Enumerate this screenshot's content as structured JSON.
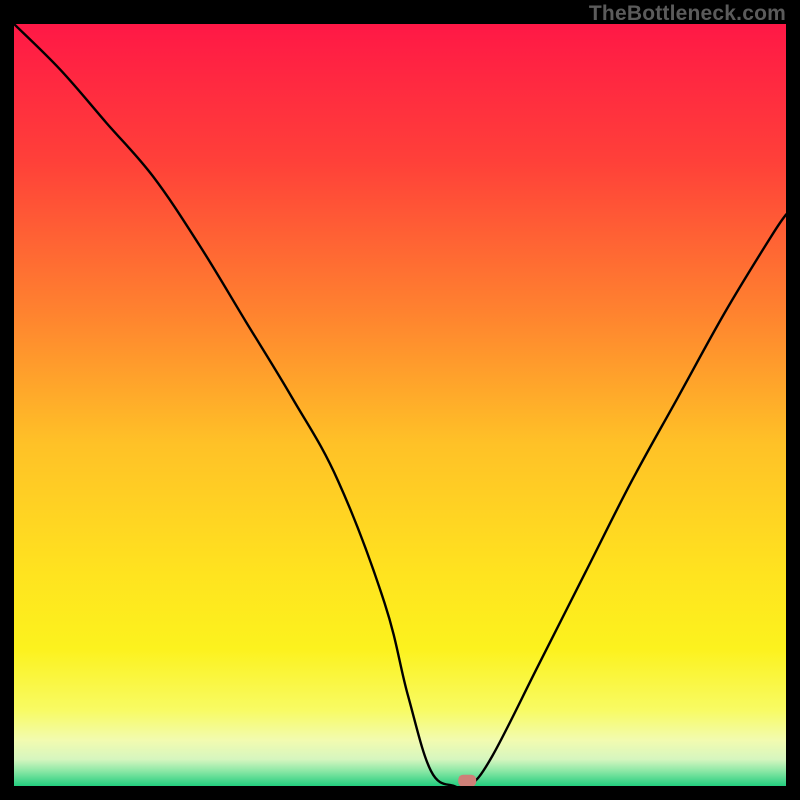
{
  "watermark": "TheBottleneck.com",
  "chart_data": {
    "type": "line",
    "title": "",
    "xlabel": "",
    "ylabel": "",
    "xlim": [
      0,
      100
    ],
    "ylim": [
      0,
      100
    ],
    "grid": false,
    "legend": false,
    "series": [
      {
        "name": "bottleneck-curve",
        "x": [
          0,
          6,
          12,
          18,
          24,
          30,
          36,
          42,
          48,
          51,
          54,
          57,
          59,
          62,
          68,
          74,
          80,
          86,
          92,
          98,
          100
        ],
        "values": [
          100,
          94,
          87,
          80,
          71,
          61,
          51,
          40,
          24,
          12,
          2,
          0,
          0,
          4,
          16,
          28,
          40,
          51,
          62,
          72,
          75
        ]
      }
    ],
    "marker": {
      "x": 58.7,
      "y": 0.7
    },
    "gradient_stops": [
      {
        "pct": 0,
        "color": "#ff1846"
      },
      {
        "pct": 18,
        "color": "#ff4039"
      },
      {
        "pct": 38,
        "color": "#ff832f"
      },
      {
        "pct": 55,
        "color": "#ffc127"
      },
      {
        "pct": 72,
        "color": "#ffe31f"
      },
      {
        "pct": 82,
        "color": "#fcf21e"
      },
      {
        "pct": 90,
        "color": "#f8fb63"
      },
      {
        "pct": 94,
        "color": "#f2fbb0"
      },
      {
        "pct": 96.5,
        "color": "#d6f6bf"
      },
      {
        "pct": 98,
        "color": "#8de8a6"
      },
      {
        "pct": 100,
        "color": "#23cd7e"
      }
    ]
  }
}
